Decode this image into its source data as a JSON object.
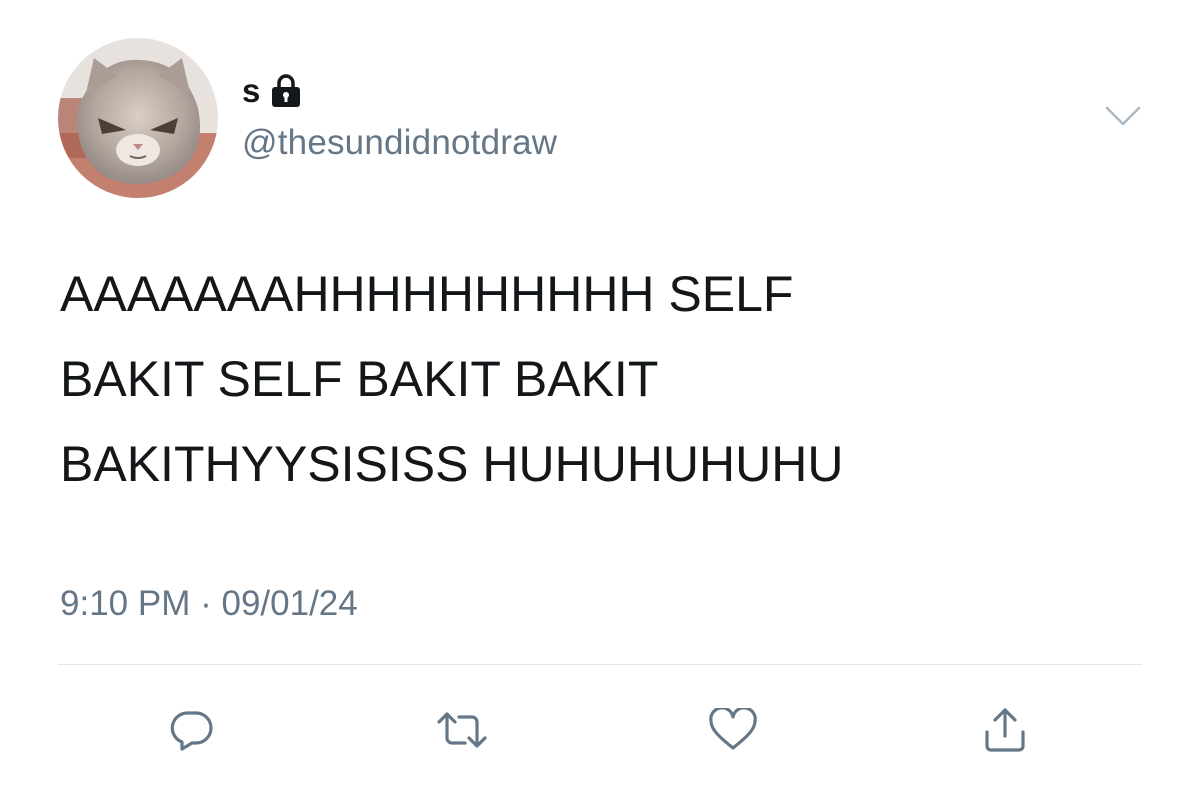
{
  "user": {
    "display_name": "s",
    "handle": "@thesundidnotdraw",
    "protected": true,
    "avatar": "cat-photo"
  },
  "tweet": {
    "text": "AAAAAAAHHHHHHHHHH SELF\nBAKIT SELF BAKIT BAKIT\nBAKITHYYSISISS HUHUHUHUHU",
    "time": "9:10 PM",
    "separator": "·",
    "date": "09/01/24"
  },
  "actions": {
    "reply_icon": "reply-icon",
    "retweet_icon": "retweet-icon",
    "like_icon": "heart-icon",
    "share_icon": "share-icon",
    "more_icon": "chevron-down-icon"
  },
  "colors": {
    "text_primary": "#14171a",
    "text_secondary": "#657786",
    "icon": "#657786",
    "divider": "#e1e8ed"
  }
}
